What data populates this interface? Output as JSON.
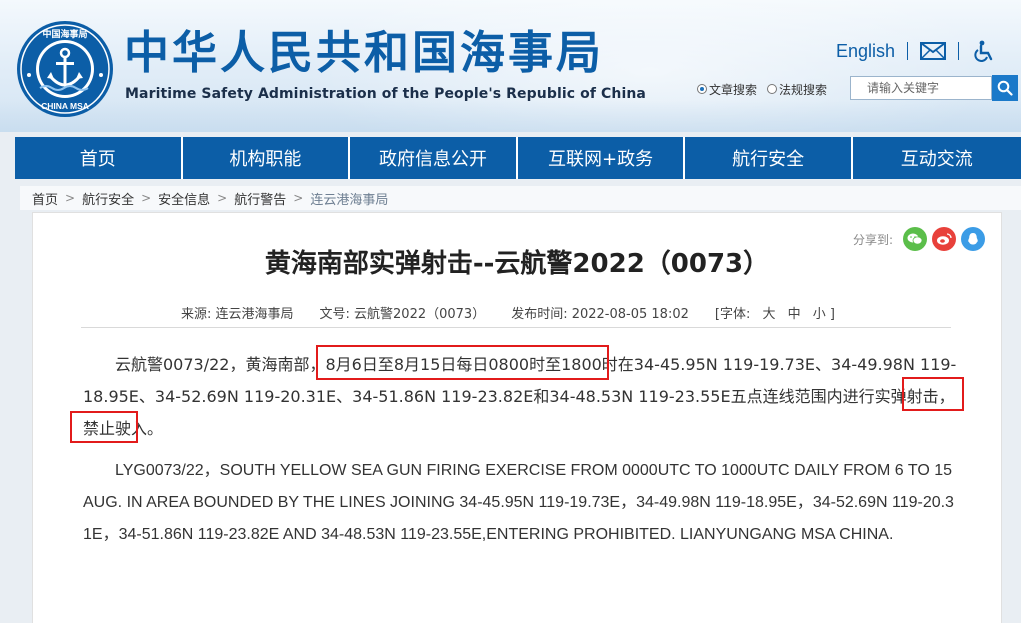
{
  "header": {
    "title_cn": "中华人民共和国海事局",
    "title_en": "Maritime Safety Administration of the People's Republic of China",
    "english_link": "English",
    "emblem_text_top": "中国海事局",
    "emblem_text_bottom": "CHINA MSA"
  },
  "search": {
    "option_article": "文章搜索",
    "option_law": "法规搜索",
    "placeholder": "请输入关键字",
    "selected": "文章搜索"
  },
  "nav": {
    "items": [
      "首页",
      "机构职能",
      "政府信息公开",
      "互联网+政务",
      "航行安全",
      "互动交流"
    ]
  },
  "breadcrumb": {
    "items": [
      "首页",
      "航行安全",
      "安全信息",
      "航行警告",
      "连云港海事局"
    ]
  },
  "article": {
    "share_label": "分享到:",
    "title": "黄海南部实弹射击--云航警2022（0073）",
    "meta": {
      "source": "来源:  连云港海事局",
      "doc_no": "文号:  云航警2022（0073）",
      "published": "发布时间:  2022-08-05 18:02",
      "font_label": "[字体:",
      "font_large": "大",
      "font_medium": "中",
      "font_small": "小 ]"
    },
    "paragraph_cn": "云航警0073/22，黄海南部，8月6日至8月15日每日0800时至1800时在34-45.95N 119-19.73E、34-49.98N 119-18.95E、34-52.69N 119-20.31E、34-51.86N 119-23.82E和34-48.53N 119-23.55E五点连线范围内进行实弹射击，禁止驶入。",
    "paragraph_en": "LYG0073/22，SOUTH YELLOW SEA GUN FIRING EXERCISE FROM 0000UTC TO 1000UTC DAILY FROM 6 TO 15 AUG. IN AREA BOUNDED BY THE LINES JOINING 34-45.95N 119-19.73E，34-49.98N 119-18.95E，34-52.69N 119-20.31E，34-51.86N 119-23.82E AND 34-48.53N 119-23.55E,ENTERING PROHIBITED. LIANYUNGANG MSA CHINA."
  },
  "colors": {
    "brand_blue": "#0c5ea7",
    "highlight_red": "#e21b1b",
    "wechat_green": "#5bbe4a",
    "weibo_red": "#e8413b",
    "qq_blue": "#3b9ce6"
  }
}
